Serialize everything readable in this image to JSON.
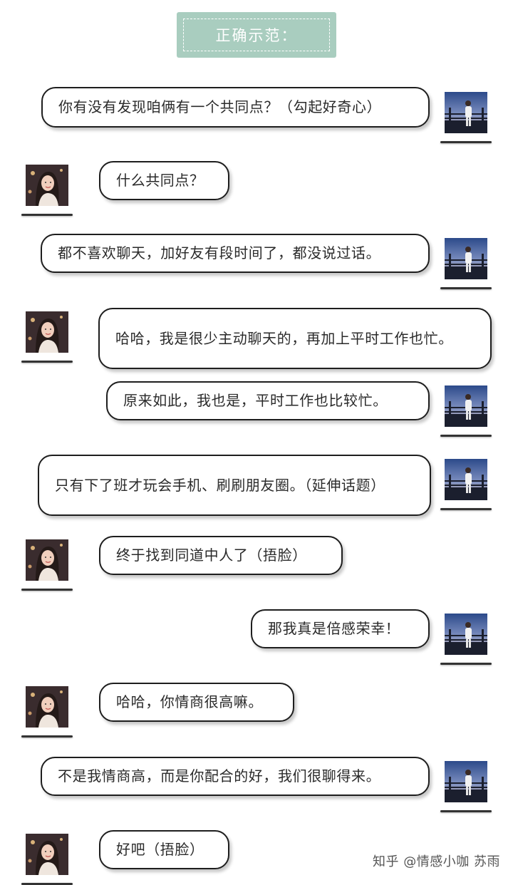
{
  "header": {
    "title": "正确示范："
  },
  "messages": [
    {
      "from": "man",
      "text": "你有没有发现咱俩有一个共同点？（勾起好奇心）"
    },
    {
      "from": "woman",
      "text": "什么共同点？"
    },
    {
      "from": "man",
      "text": "都不喜欢聊天，加好友有段时间了，都没说过话。"
    },
    {
      "from": "woman",
      "text": "哈哈，我是很少主动聊天的，再加上平时工作也忙。"
    },
    {
      "from": "man",
      "text": "原来如此，我也是，平时工作也比较忙。"
    },
    {
      "from": "man",
      "text": "只有下了班才玩会手机、刷刷朋友圈。（延伸话题）"
    },
    {
      "from": "woman",
      "text": "终于找到同道中人了（捂脸）"
    },
    {
      "from": "man",
      "text": "那我真是倍感荣幸！"
    },
    {
      "from": "woman",
      "text": "哈哈，你情商很高嘛。"
    },
    {
      "from": "man",
      "text": "不是我情商高，而是你配合的好，我们很聊得来。"
    },
    {
      "from": "woman",
      "text": "好吧（捂脸）"
    }
  ],
  "avatars": {
    "man": "man-avatar-photo",
    "woman": "woman-avatar-photo"
  },
  "watermark": "知乎 @情感小咖 苏雨",
  "colors": {
    "title_bg": "#a9cdbf",
    "bubble_border": "#1e1e1e"
  }
}
